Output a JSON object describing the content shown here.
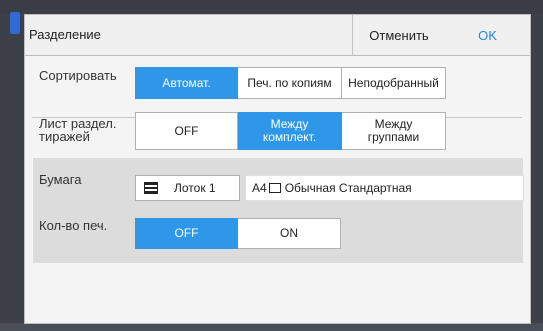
{
  "dialog": {
    "title": "Разделение",
    "cancel_label": "Отменить",
    "ok_label": "OK"
  },
  "sort": {
    "label": "Сортировать",
    "options": [
      "Автомат.",
      "Печ. по копиям",
      "Неподобранный"
    ],
    "selected": "Автомат."
  },
  "separator_sheet": {
    "label_line1": "Лист раздел.",
    "label_line2": "тиражей",
    "options": [
      {
        "line1": "OFF",
        "line2": ""
      },
      {
        "line1": "Между",
        "line2": "комплект."
      },
      {
        "line1": "Между",
        "line2": "группами"
      }
    ],
    "selected": "Между комплект."
  },
  "paper": {
    "label": "Бумага",
    "tray_label": "Лоток 1",
    "tray_icon": "tray-icon",
    "size": "A4",
    "paper_icon": "paper-orientation-icon",
    "type": "Обычная Стандартная"
  },
  "copies": {
    "label": "Кол-во печ.",
    "options": [
      "OFF",
      "ON"
    ],
    "selected": "OFF"
  },
  "colors": {
    "accent": "#2e97e8",
    "ok_text": "#1e88e5"
  }
}
